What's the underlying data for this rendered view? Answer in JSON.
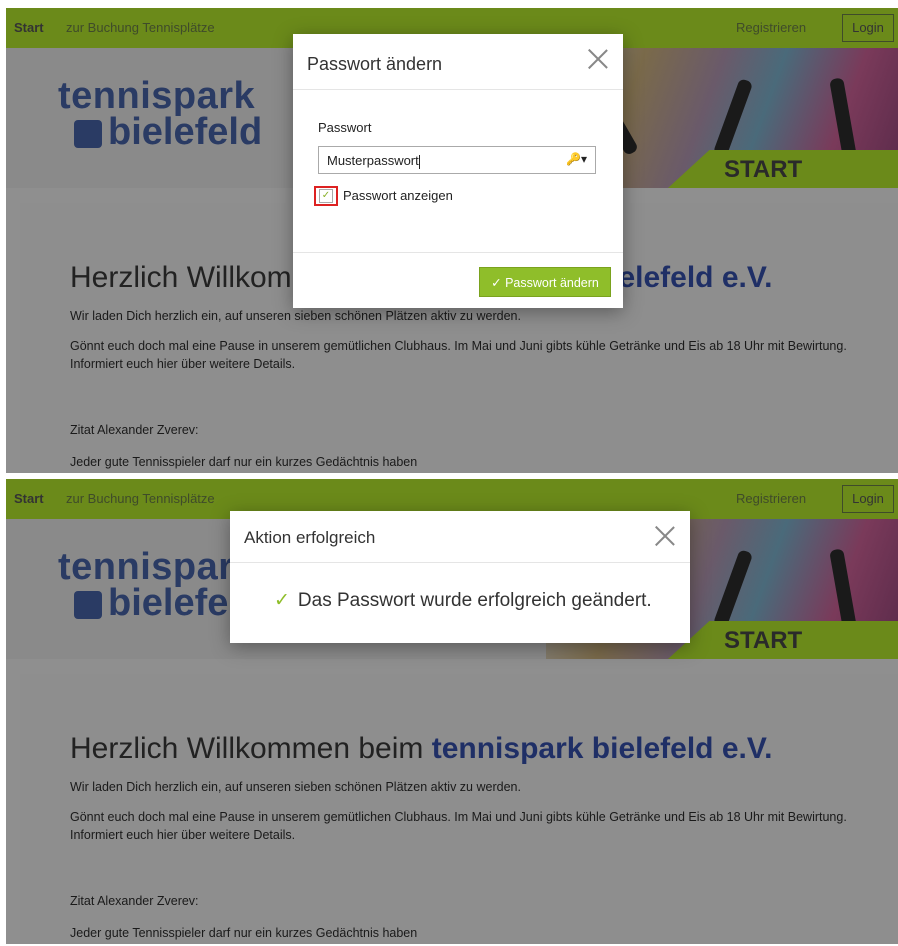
{
  "nav": {
    "start": "Start",
    "booking": "zur Buchung Tennisplätze",
    "register": "Registrieren",
    "login": "Login"
  },
  "logo": {
    "line1": "tennispark",
    "line2": "bielefeld"
  },
  "banner": {
    "label": "START"
  },
  "page": {
    "heading_prefix": "Herzlich Willkommen beim ",
    "heading_brand": "tennispark bielefeld e.V.",
    "p1": "Wir laden Dich herzlich ein, auf unseren sieben schönen Plätzen aktiv zu werden.",
    "p2": "Gönnt euch doch mal eine Pause in unserem gemütlichen Clubhaus. Im Mai und Juni gibts kühle Getränke und Eis ab 18 Uhr mit Bewirtung.",
    "p3": "Informiert euch hier über weitere Details.",
    "quote_author": "Zitat Alexander Zverev:",
    "quote_text": "Jeder gute Tennisspieler darf nur ein kurzes Gedächtnis haben"
  },
  "modal_change": {
    "title": "Passwort ändern",
    "field_label": "Passwort",
    "field_value": "Musterpasswort",
    "show_label": "Passwort anzeigen",
    "submit_label": "Passwort ändern"
  },
  "modal_success": {
    "title": "Aktion erfolgreich",
    "message": "Das Passwort wurde erfolgreich geändert."
  },
  "colors": {
    "accent": "#8fbe2a",
    "nav": "#6b8a1a",
    "brand": "#1f2f66",
    "highlight": "#d22222"
  }
}
